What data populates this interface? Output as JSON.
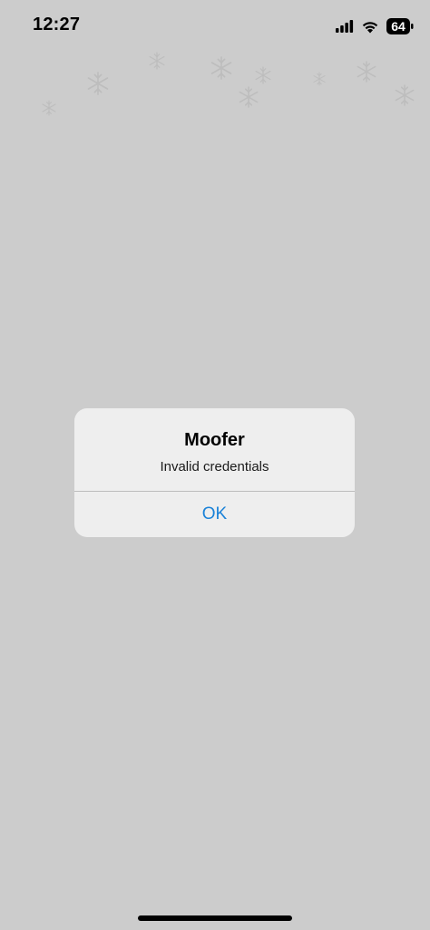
{
  "status_bar": {
    "time": "12:27",
    "battery_level": "64",
    "icons": [
      "cellular-signal-icon",
      "wifi-icon",
      "battery-icon"
    ]
  },
  "alert": {
    "title": "Moofer",
    "message": "Invalid credentials",
    "ok_label": "OK"
  },
  "colors": {
    "background": "#cccccc",
    "alert_background": "#eeeeee",
    "accent": "#1a82d8"
  }
}
